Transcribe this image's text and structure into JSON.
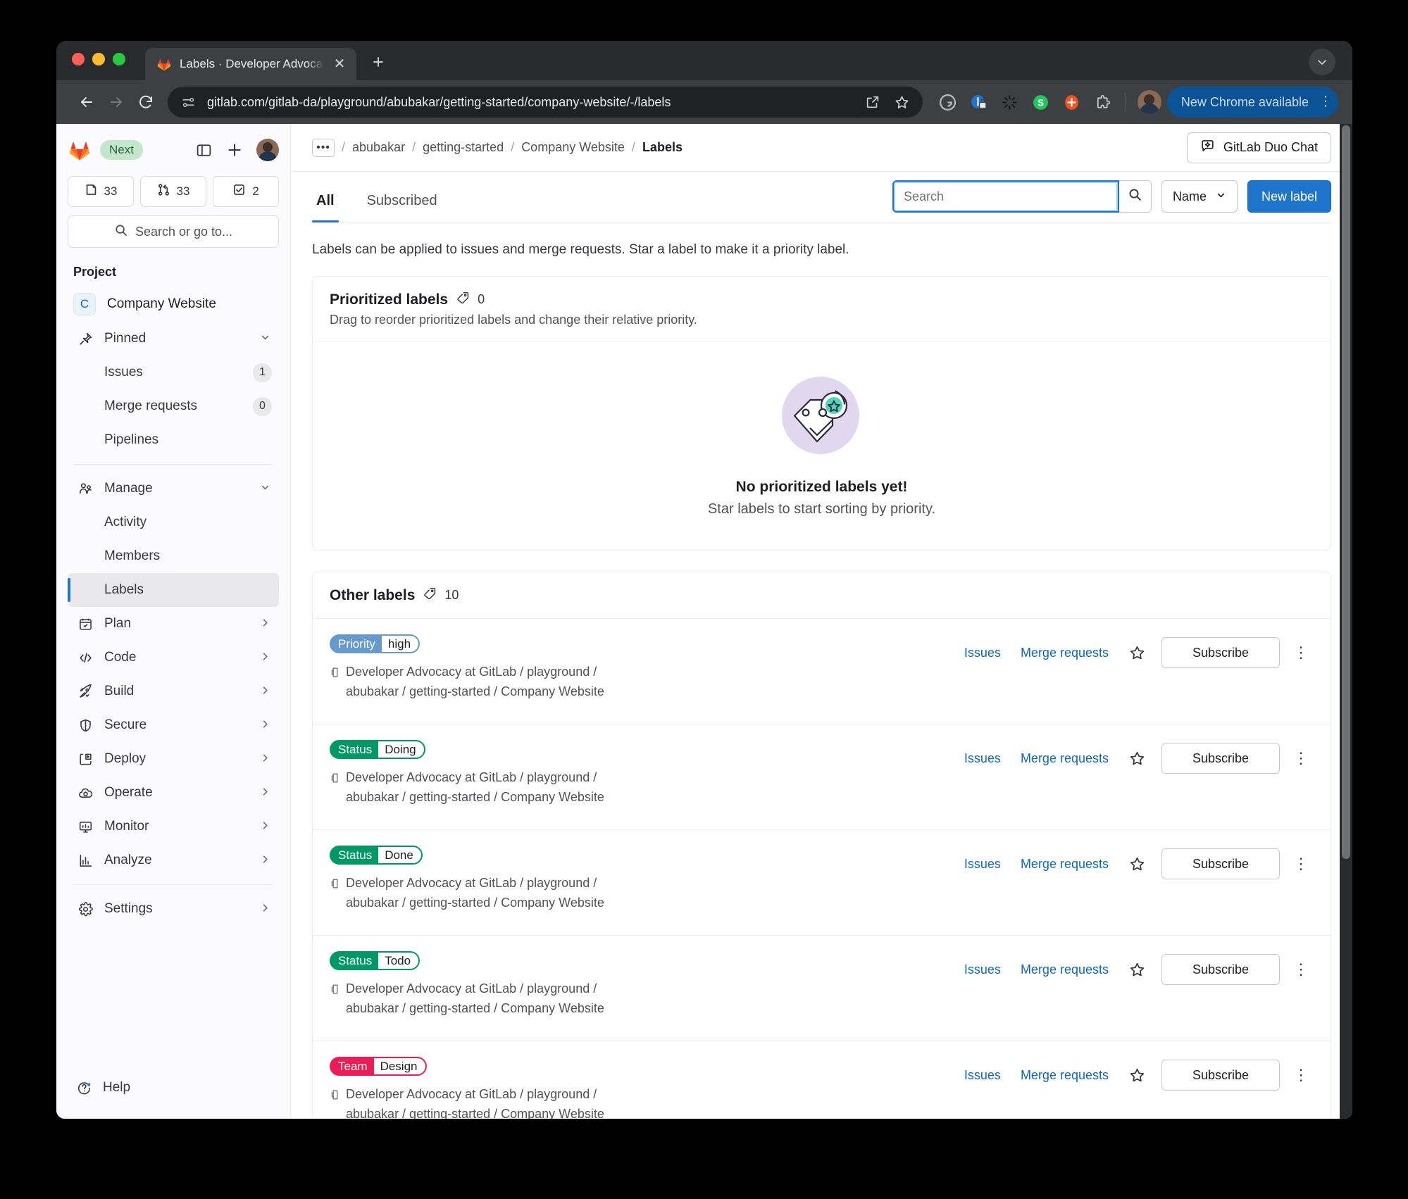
{
  "browser": {
    "tab": {
      "title": "Labels · Developer Advocacy",
      "favicon": "gitlab-favicon",
      "close_label": "✕"
    },
    "new_tab_label": "+",
    "toolbar": {
      "back_icon": "back-arrow-icon",
      "forward_icon": "forward-arrow-icon",
      "reload_icon": "reload-icon",
      "site_info_icon": "site-settings-icon",
      "url": "gitlab.com/gitlab-da/playground/abubakar/getting-started/company-website/-/labels",
      "share_icon": "share-icon",
      "bookmark_icon": "star-icon",
      "extensions": [
        "grammarly-extension-icon",
        "bitwarden-extension-icon",
        "loading-spinner-icon",
        "sessionbox-extension-icon",
        "plus-extension-icon",
        "puzzle-extensions-icon"
      ],
      "profile_icon": "profile-avatar",
      "update_label": "New Chrome available",
      "update_menu_icon": "kebab-menu-icon"
    }
  },
  "sidebar": {
    "logo": "gitlab-logo",
    "next_badge": "Next",
    "collapse_icon": "sidebar-toggle-icon",
    "create_icon": "plus-icon",
    "avatar": "user-avatar",
    "counters": [
      {
        "icon": "issues-icon",
        "value": "33"
      },
      {
        "icon": "merge-request-icon",
        "value": "33"
      },
      {
        "icon": "todo-checkbox-icon",
        "value": "2"
      }
    ],
    "search_placeholder": "Search or go to...",
    "search_icon": "search-icon",
    "section_title": "Project",
    "project": {
      "initial": "C",
      "name": "Company Website"
    },
    "items": [
      {
        "label": "Pinned",
        "icon": "pin-icon",
        "chevron": "chevron-down-icon",
        "sub": false
      },
      {
        "label": "Issues",
        "icon": "",
        "count": "1",
        "sub": true
      },
      {
        "label": "Merge requests",
        "icon": "",
        "count": "0",
        "sub": true
      },
      {
        "label": "Pipelines",
        "icon": "",
        "sub": true
      },
      {
        "label": "Manage",
        "icon": "users-icon",
        "chevron": "chevron-down-icon",
        "sub": false,
        "divider_before": true
      },
      {
        "label": "Activity",
        "icon": "",
        "sub": true
      },
      {
        "label": "Members",
        "icon": "",
        "sub": true
      },
      {
        "label": "Labels",
        "icon": "",
        "sub": true,
        "active": true
      },
      {
        "label": "Plan",
        "icon": "calendar-icon",
        "chevron": "chevron-right-icon",
        "sub": false
      },
      {
        "label": "Code",
        "icon": "code-icon",
        "chevron": "chevron-right-icon",
        "sub": false
      },
      {
        "label": "Build",
        "icon": "rocket-icon",
        "chevron": "chevron-right-icon",
        "sub": false
      },
      {
        "label": "Secure",
        "icon": "shield-icon",
        "chevron": "chevron-right-icon",
        "sub": false
      },
      {
        "label": "Deploy",
        "icon": "deploy-icon",
        "chevron": "chevron-right-icon",
        "sub": false
      },
      {
        "label": "Operate",
        "icon": "cloud-icon",
        "chevron": "chevron-right-icon",
        "sub": false
      },
      {
        "label": "Monitor",
        "icon": "monitor-icon",
        "chevron": "chevron-right-icon",
        "sub": false
      },
      {
        "label": "Analyze",
        "icon": "chart-icon",
        "chevron": "chevron-right-icon",
        "sub": false
      },
      {
        "label": "Settings",
        "icon": "gear-icon",
        "chevron": "chevron-right-icon",
        "sub": false,
        "divider_before": true
      }
    ],
    "help": {
      "label": "Help",
      "icon": "help-icon"
    }
  },
  "breadcrumb": {
    "more_label": "•••",
    "items": [
      "abubakar",
      "getting-started",
      "Company Website"
    ],
    "current": "Labels",
    "duo_chat_label": "GitLab Duo Chat",
    "duo_chat_icon": "duo-chat-icon"
  },
  "toolbar": {
    "tabs": [
      {
        "label": "All",
        "active": true
      },
      {
        "label": "Subscribed",
        "active": false
      }
    ],
    "search_placeholder": "Search",
    "search_value": "",
    "search_icon": "search-icon",
    "sort_label": "Name",
    "sort_chevron": "chevron-down-icon",
    "new_label_button": "New label"
  },
  "intro": "Labels can be applied to issues and merge requests. Star a label to make it a priority label.",
  "prioritized": {
    "title": "Prioritized labels",
    "count": "0",
    "tag_icon": "label-tag-icon",
    "subtitle": "Drag to reorder prioritized labels and change their relative priority.",
    "empty_title": "No prioritized labels yet!",
    "empty_subtitle": "Star labels to start sorting by priority.",
    "empty_illustration": "priority-label-illustration"
  },
  "other_labels": {
    "title": "Other labels",
    "count": "10",
    "tag_icon": "label-tag-icon",
    "row_actions": {
      "issues": "Issues",
      "merge_requests": "Merge requests",
      "star_icon": "star-icon",
      "subscribe": "Subscribe",
      "kebab_icon": "kebab-menu-icon"
    },
    "project_path": "Developer Advocacy at GitLab / playground / abubakar / getting-started / Company Website",
    "project_icon": "project-icon",
    "rows": [
      {
        "scope": "Priority",
        "value": "high",
        "color": "#6699cc"
      },
      {
        "scope": "Status",
        "value": "Doing",
        "color": "#009966"
      },
      {
        "scope": "Status",
        "value": "Done",
        "color": "#009966"
      },
      {
        "scope": "Status",
        "value": "Todo",
        "color": "#009966"
      },
      {
        "scope": "Team",
        "value": "Design",
        "color": "#ed1c56"
      }
    ]
  },
  "colors": {
    "accent_blue": "#1f75cb",
    "link_blue": "#1068bf",
    "chrome_update_bg": "#0b5394",
    "next_badge_bg": "#c3e6cd"
  }
}
